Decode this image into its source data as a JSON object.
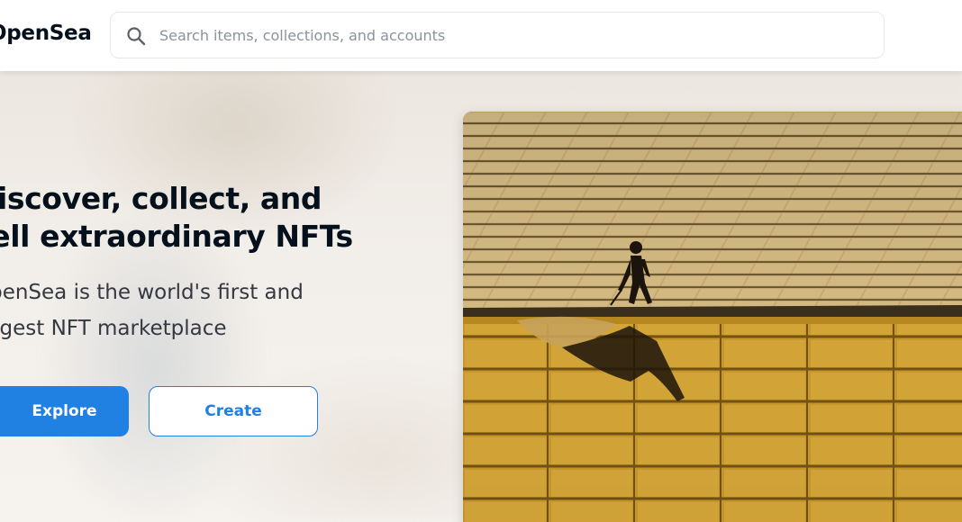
{
  "header": {
    "logo_text": "OpenSea",
    "search": {
      "icon": "search-icon",
      "placeholder": "Search items, collections, and accounts"
    }
  },
  "hero": {
    "title": "Discover, collect, and sell extraordinary NFTs",
    "subtitle": "OpenSea is the world's first and largest NFT marketplace",
    "explore_label": "Explore",
    "create_label": "Create"
  },
  "colors": {
    "accent": "#2081e2",
    "text_dark": "#04111d",
    "text_body": "#353840",
    "placeholder": "#8a939b"
  }
}
